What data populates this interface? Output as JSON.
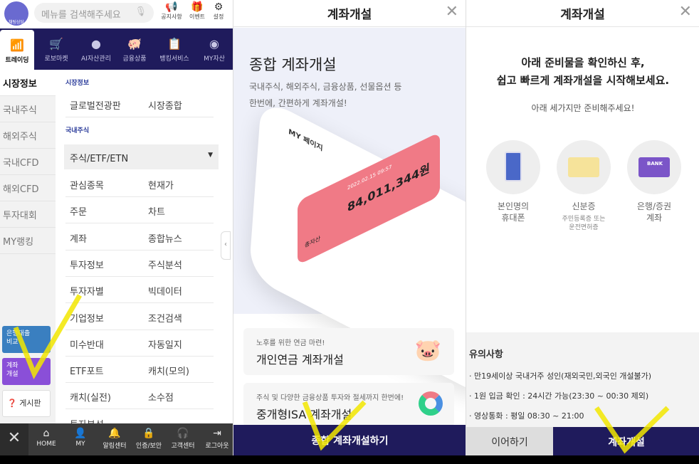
{
  "panel1": {
    "logo_text": "채팅상담",
    "search_placeholder": "메뉴를 검색해주세요",
    "top_icons": [
      {
        "label": "공지사항",
        "icon": "megaphone-icon"
      },
      {
        "label": "이벤트",
        "icon": "gift-icon"
      },
      {
        "label": "설정",
        "icon": "gear-icon"
      }
    ],
    "tabs": [
      {
        "label": "트레이딩",
        "icon": "chart-icon",
        "active": true
      },
      {
        "label": "로보마켓",
        "icon": "cart-icon"
      },
      {
        "label": "AI자산관리",
        "icon": "ai-head-icon"
      },
      {
        "label": "금융상품",
        "icon": "piggy-icon"
      },
      {
        "label": "뱅킹서비스",
        "icon": "clipboard-icon"
      },
      {
        "label": "MY자산",
        "icon": "donut-icon"
      }
    ],
    "sidebar": [
      "시장정보",
      "국내주식",
      "해외주식",
      "국내CFD",
      "해외CFD",
      "투자대회",
      "MY랭킹"
    ],
    "cards": {
      "loan": "은행대출 비교",
      "account": "계좌 개설",
      "board": "게시판"
    },
    "section1": "시장정보",
    "row0": [
      "글로벌전광판",
      "시장종합"
    ],
    "section2": "국내주식",
    "dropdown": "주식/ETF/ETN",
    "rows": [
      [
        "관심종목",
        "현재가"
      ],
      [
        "주문",
        "차트"
      ],
      [
        "계좌",
        "종합뉴스"
      ],
      [
        "투자정보",
        "주식분석"
      ],
      [
        "투자자별",
        "빅데이터"
      ],
      [
        "기업정보",
        "조건검색"
      ],
      [
        "미수반대",
        "자동일지"
      ],
      [
        "ETF포트",
        "캐치(모의)"
      ],
      [
        "캐치(실전)",
        "소수점"
      ],
      [
        "투자분석",
        ""
      ]
    ],
    "bottom": [
      {
        "label": "HOME",
        "icon": "home-icon"
      },
      {
        "label": "MY",
        "icon": "user-icon"
      },
      {
        "label": "알림센터",
        "icon": "bell-icon"
      },
      {
        "label": "인증/보안",
        "icon": "lock-icon"
      },
      {
        "label": "고객센터",
        "icon": "headset-icon"
      },
      {
        "label": "로그아웃",
        "icon": "logout-icon"
      }
    ]
  },
  "panel2": {
    "title": "계좌개설",
    "hero_title": "종합 계좌개설",
    "hero_sub1": "국내주식, 해외주식, 금융상품, 선물옵션 등",
    "hero_sub2": "한번에, 간편하게 계좌개설!",
    "mock": {
      "page": "MY 페이지",
      "amount": "84,011,344원",
      "label": "총자산",
      "date": "2022.02.15 09:57"
    },
    "cards": [
      {
        "sub": "노후를 위한 연금 마련!",
        "title": "개인연금 계좌개설"
      },
      {
        "sub": "주식 및 다양한 금융상품 투자와 절세까지 한번에!",
        "title": "중개형ISA 계좌개설"
      }
    ],
    "button": "종합 계좌개설하기"
  },
  "panel3": {
    "title": "계좌개설",
    "intro1": "아래 준비물을 확인하신 후,",
    "intro2": "쉽고 빠르게 계좌개설을 시작해보세요.",
    "intro3": "아래 세가지만 준비해주세요!",
    "items": [
      {
        "l1": "본인명의",
        "l2": "휴대폰",
        "icon": "phone-icon"
      },
      {
        "l1": "신분증",
        "sub1": "주민등록증 또는",
        "sub2": "운전면허증",
        "icon": "id-card-icon"
      },
      {
        "l1": "은행/증권",
        "l2": "계좌",
        "icon": "bank-card-icon",
        "card_text": "BANK"
      }
    ],
    "notice_title": "유의사항",
    "notices": [
      "· 만19세이상 국내거주 성인(재외국민,외국인 개설불가)",
      "· 1원 입금 확인 : 24시간 가능(23:30 ~ 00:30 제외)",
      "· 영상통화 : 평일 08:30 ~ 21:00"
    ],
    "continue_button": "이어하기",
    "open_button": "계좌개설"
  },
  "colors": {
    "navy": "#1f1b5c",
    "annotation": "#f2e600",
    "account_card": "#8a4fd8",
    "loan_card": "#3a7fc0"
  }
}
